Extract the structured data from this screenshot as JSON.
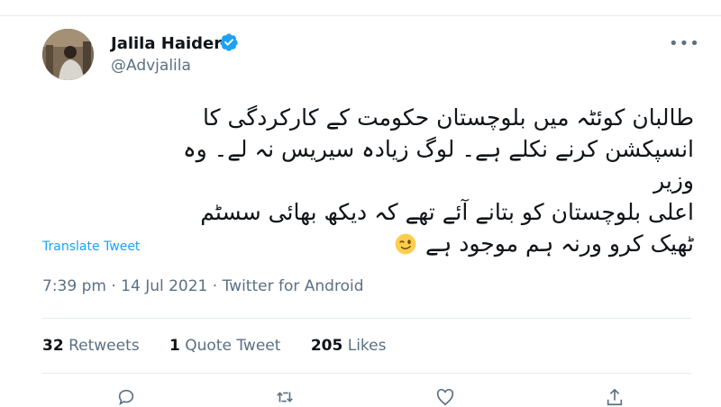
{
  "tweet": {
    "author": {
      "name": "Jalila Haider",
      "handle": "@Advjalila",
      "verified": true
    },
    "text_lines": [
      "طالبان کوئٹہ میں بلوچستان حکومت کے کارکردگی کا",
      "انسپکشن کرنے نکلے ہے۔ لوگ زیادہ سیریس نہ لے۔ وہ وزیر",
      "اعلی بلوچستان کو بتانے آئے تھے کہ دیکھ بھائی سسٹم",
      "ٹھیک کرو ورنہ ہم موجود ہے"
    ],
    "emoji": "winking-face",
    "translate_label": "Translate Tweet",
    "time": "7:39 pm",
    "date": "14 Jul 2021",
    "source": "Twitter for Android",
    "separator": "·",
    "stats": {
      "retweets_count": "32",
      "retweets_label": "Retweets",
      "quote_count": "1",
      "quote_label": "Quote Tweet",
      "likes_count": "205",
      "likes_label": "Likes"
    }
  },
  "icons": {
    "verified": "verified-badge-icon",
    "more": "more-options-icon",
    "reply": "reply-icon",
    "retweet": "retweet-icon",
    "like": "like-icon",
    "share": "share-icon"
  },
  "colors": {
    "accent": "#1da1f2",
    "secondary_text": "#5b7083",
    "primary_text": "#0f1419",
    "divider": "#e6ecf0"
  }
}
